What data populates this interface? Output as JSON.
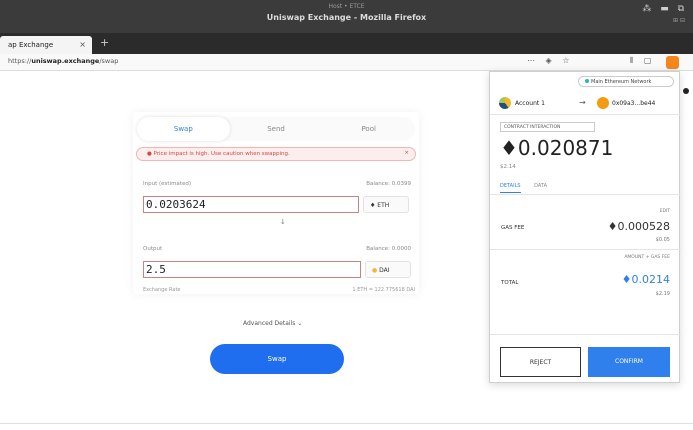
{
  "window": {
    "host": "Host • ETCE",
    "title": "Uniswap Exchange - Mozilla Firefox",
    "controls": "⁂ ▬ ⧉",
    "controls_sub": "⊞ ⊟"
  },
  "browser": {
    "tab_title": "ap Exchange",
    "tab_close": "×",
    "new_tab": "+",
    "url_prefix": "https://",
    "url_host": "uniswap.exchange",
    "url_path": "/swap",
    "nav_icons": "⋯ ◈ ☆",
    "right_icons": "⫴ ▢"
  },
  "uniswap": {
    "tabs": [
      "Swap",
      "Send",
      "Pool"
    ],
    "error_text": "● Price impact is high. Use caution when swapping.",
    "error_close": "×",
    "input_label": "Input (estimated)",
    "input_balance": "Balance: 0.0399",
    "input_value": "0.0203624",
    "input_token": "♦ ETH",
    "output_label": "Output",
    "output_balance": "Balance: 0.0000",
    "output_value": "2.5",
    "output_token_icon": "●",
    "output_token": "DAI",
    "down_arrow": "↓",
    "rate_label": "Exchange Rate",
    "rate_value": "1 ETH = 122.775618 DAI",
    "advanced": "Advanced Details ⌄",
    "swap_button": "Swap"
  },
  "metamask": {
    "network": "Main Ethereum Network",
    "from_account": "Account 1",
    "arrow": "→",
    "to_account": "0x09a3...be44",
    "contract_label": "CONTRACT INTERACTION",
    "amount": "♦0.020871",
    "amount_usd": "$2.14",
    "tab_details": "DETAILS",
    "tab_data": "DATA",
    "gas_label": "GAS FEE",
    "gas_edit": "EDIT",
    "gas_value": "♦0.000528",
    "gas_usd": "$0.05",
    "total_label": "TOTAL",
    "total_sub": "AMOUNT + GAS FEE",
    "total_value": "♦0.0214",
    "total_usd": "$2.19",
    "reject": "REJECT",
    "confirm": "CONFIRM"
  },
  "colors": {
    "accent": "#2f80ed",
    "swap_button": "#1f6ef0",
    "error": "#d64545",
    "metamask_orange": "#f6851b"
  }
}
